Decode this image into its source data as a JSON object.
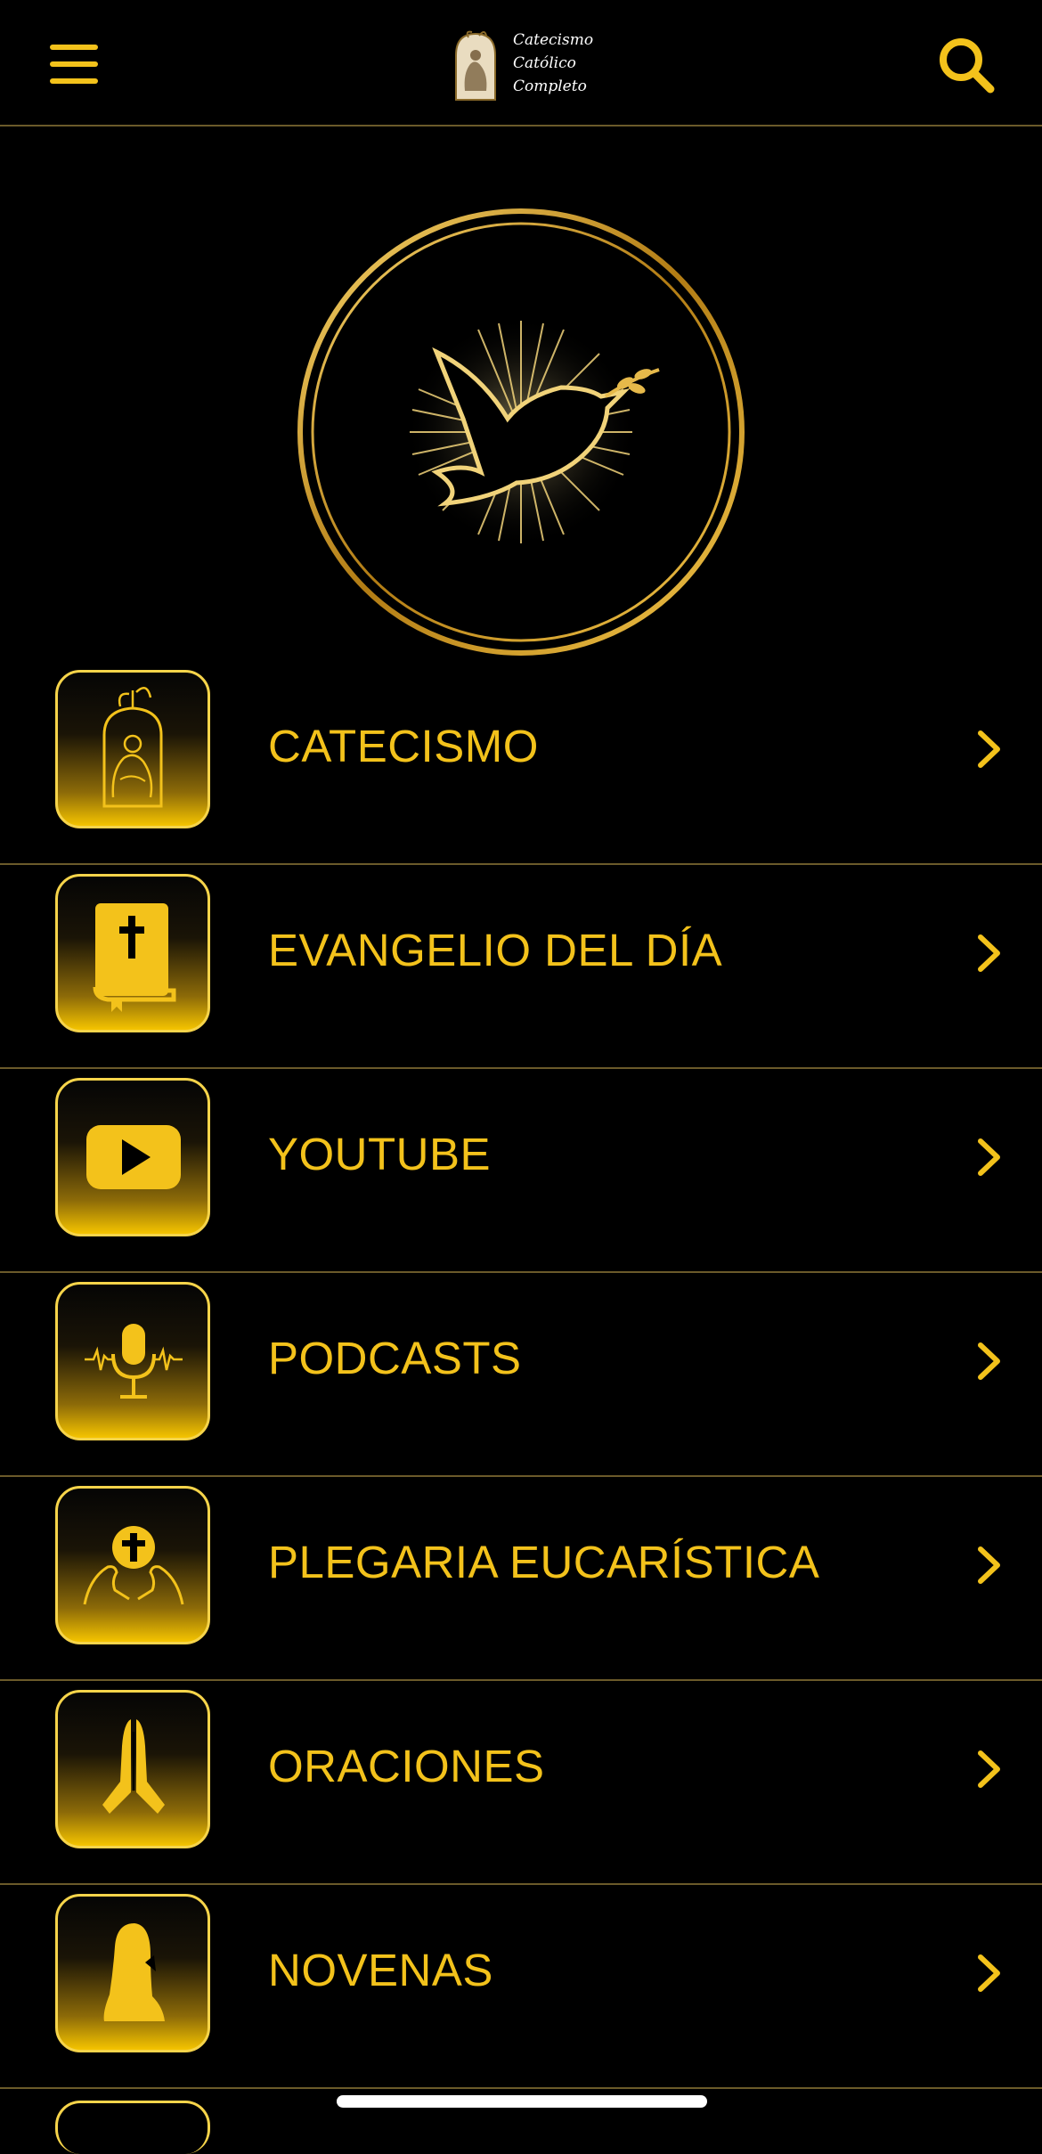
{
  "header": {
    "logo_lines": [
      "Catecismo",
      "Católico",
      "Completo"
    ],
    "menu_icon": "hamburger-menu-icon",
    "search_icon": "search-icon"
  },
  "hero_icon": "dove-with-olive-branch-icon",
  "menu_items": [
    {
      "label": "CATECISMO",
      "icon": "holy-family-icon"
    },
    {
      "label": "EVANGELIO DEL DÍA",
      "icon": "bible-icon"
    },
    {
      "label": "YOUTUBE",
      "icon": "youtube-play-icon"
    },
    {
      "label": "PODCASTS",
      "icon": "microphone-icon"
    },
    {
      "label": "PLEGARIA EUCARÍSTICA",
      "icon": "eucharist-host-icon"
    },
    {
      "label": "ORACIONES",
      "icon": "praying-hands-icon"
    },
    {
      "label": "NOVENAS",
      "icon": "kneeling-virgin-icon"
    }
  ],
  "colors": {
    "accent": "#f3c21b",
    "background": "#000000",
    "divider": "#6b5a2a"
  }
}
